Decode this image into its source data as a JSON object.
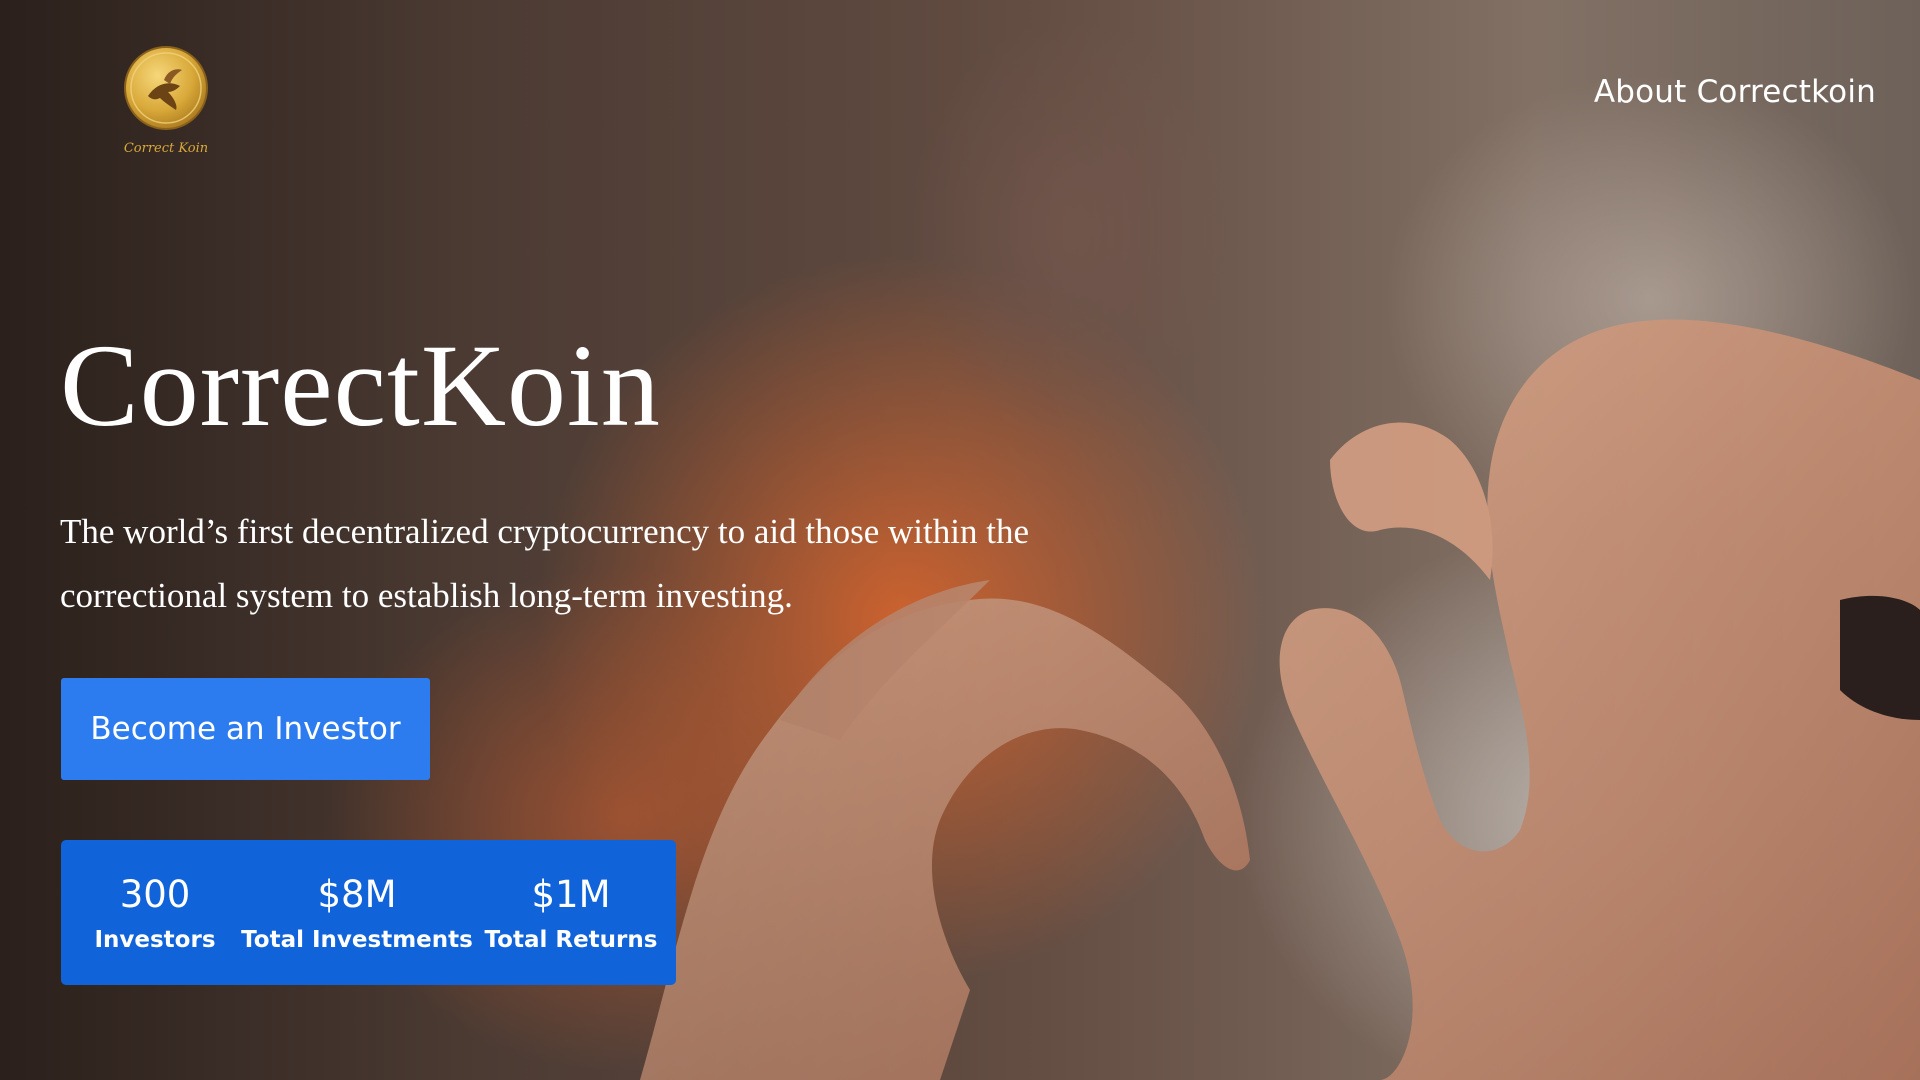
{
  "brand": {
    "logo_script": "Correct Koin",
    "title": "CorrectKoin",
    "tagline": "The world’s first decentralized cryptocurrency to aid those within the correctional system to establish long-term investing."
  },
  "nav": {
    "about_label": "About Correctkoin"
  },
  "cta": {
    "label": "Become an Investor"
  },
  "stats": [
    {
      "value": "300",
      "label": "Investors"
    },
    {
      "value": "$8M",
      "label": "Total Investments"
    },
    {
      "value": "$1M",
      "label": "Total Returns"
    }
  ],
  "colors": {
    "cta_blue": "#2c7cf0",
    "stats_blue": "#1163d9",
    "logo_gold": "#d9a93a",
    "text": "#ffffff"
  },
  "icons": {
    "logo": "gold-coin-bird-logo"
  }
}
